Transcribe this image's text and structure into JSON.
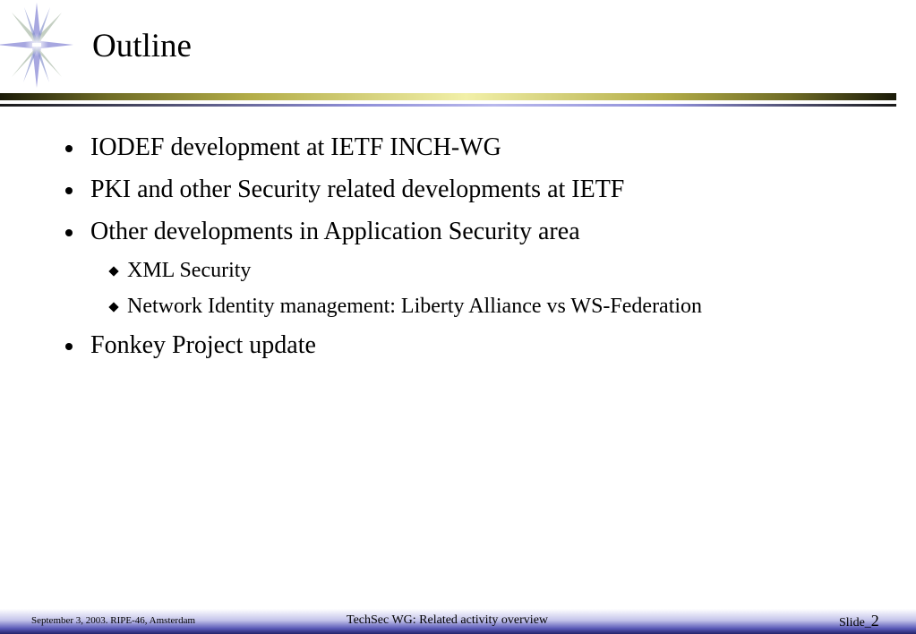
{
  "slide": {
    "title": "Outline"
  },
  "bullets": [
    {
      "text": "IODEF development at IETF INCH-WG"
    },
    {
      "text": "PKI and other Security related developments at IETF"
    },
    {
      "text": "Other developments in Application Security area"
    },
    {
      "text": "XML Security"
    },
    {
      "text": "Network Identity management: Liberty Alliance vs WS-Federation"
    },
    {
      "text": "Fonkey Project update"
    }
  ],
  "footer": {
    "left": "September 3, 2003. RIPE-46, Amsterdam",
    "center": "TechSec WG: Related activity overview",
    "slide_label": "Slide_",
    "slide_number": "2"
  },
  "icons": {
    "logo": "starburst-icon",
    "level1_bullet": "round-bullet-icon",
    "level2_bullet": "diamond-bullet-icon"
  },
  "colors": {
    "rule_gold": "#f2f0a8",
    "rule_blue": "#8f8fd8",
    "footer_band": "#5a5ab8"
  }
}
